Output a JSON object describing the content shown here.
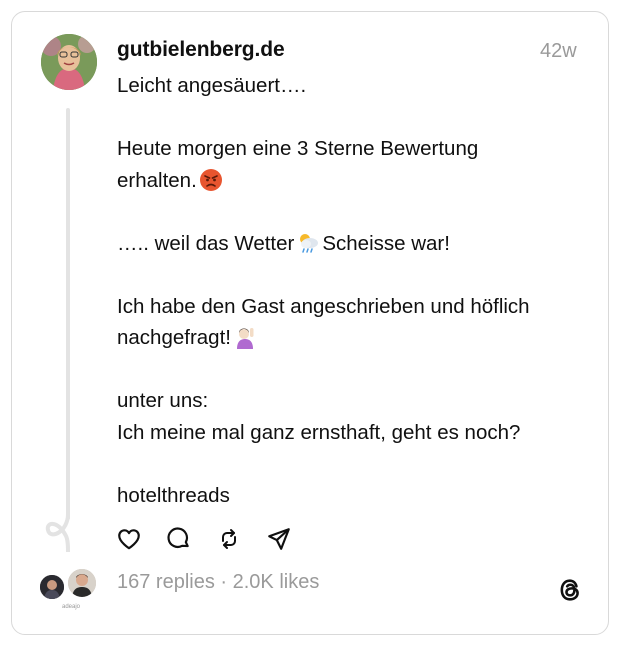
{
  "post": {
    "username": "gutbielenberg.de",
    "timestamp": "42w",
    "paragraphs": {
      "p1": "Leicht angesäuert….",
      "p2a": "Heute morgen eine 3 Sterne Bewertung\nerhalten.",
      "p3a": "….. weil das Wetter",
      "p3b": "Scheisse war!",
      "p4a": "Ich habe den Gast angeschrieben und höflich\nnachgefragt!",
      "p5": "unter uns:\nIch meine mal ganz ernsthaft, geht es noch?",
      "p6": "hotelthreads"
    },
    "emojis": [
      "angry-face",
      "sun-behind-rain-cloud",
      "person-raising-hand"
    ]
  },
  "actions": [
    {
      "name": "like",
      "icon": "heart-icon"
    },
    {
      "name": "reply",
      "icon": "comment-icon"
    },
    {
      "name": "repost",
      "icon": "repost-icon"
    },
    {
      "name": "share",
      "icon": "send-icon"
    }
  ],
  "footer": {
    "stats": "167 replies · 2.0K likes",
    "reply_avatar_caption": "adeajo",
    "logo": "threads-logo"
  },
  "colors": {
    "text": "#101010",
    "muted": "#9a9a9a",
    "border": "#d9d9d9",
    "thread_line": "#e3e3e3"
  }
}
